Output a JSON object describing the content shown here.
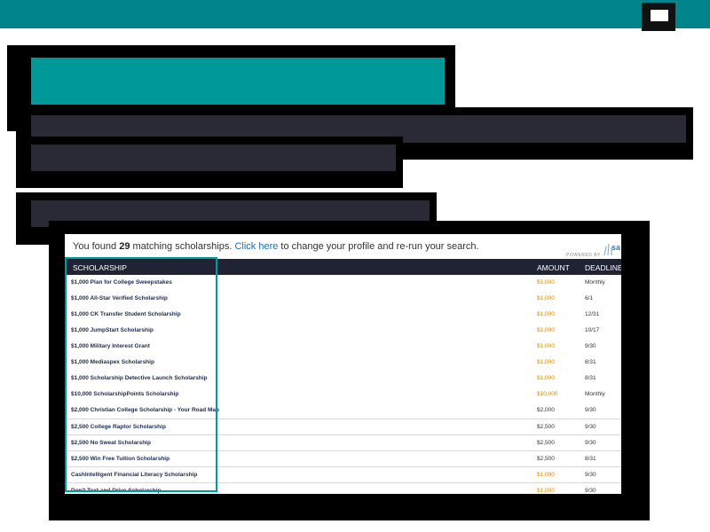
{
  "colors": {
    "brand": "#00838a",
    "accent": "#00999a",
    "dark": "#2a2a37",
    "link": "#1a6fb5",
    "amount": "#d98a00"
  },
  "header": {
    "menu_icon": "hamburger-menu-icon"
  },
  "screenshot": {
    "found_prefix": "You found ",
    "found_count": "29",
    "found_middle": " matching scholarships. ",
    "change_link": "Click here",
    "found_suffix": " to change your profile and re-run your search.",
    "powered_by": "POWERED BY",
    "logo_text": "sa",
    "columns": {
      "name": "SCHOLARSHIP",
      "amount": "AMOUNT",
      "deadline": "DEADLINE"
    },
    "rows": [
      {
        "name": "$1,000 Plan for College Sweepstakes",
        "amount": "$1,000",
        "deadline": "Monthly"
      },
      {
        "name": "$1,000 All-Star Verified Scholarship",
        "amount": "$1,000",
        "deadline": "6/1"
      },
      {
        "name": "$1,000 CK Transfer Student Scholarship",
        "amount": "$1,000",
        "deadline": "12/31"
      },
      {
        "name": "$1,000 JumpStart Scholarship",
        "amount": "$1,000",
        "deadline": "10/17"
      },
      {
        "name": "$1,000 Military Interest Grant",
        "amount": "$1,000",
        "deadline": "9/30"
      },
      {
        "name": "$1,000 Mediaspex Scholarship",
        "amount": "$1,000",
        "deadline": "8/31"
      },
      {
        "name": "$1,000 Scholarship Detective Launch Scholarship",
        "amount": "$1,000",
        "deadline": "8/31"
      },
      {
        "name": "$10,000 ScholarshipPoints Scholarship",
        "amount": "$10,000",
        "deadline": "Monthly"
      },
      {
        "name": "$2,000 Christian College Scholarship - Your Road Map",
        "amount": "$2,000",
        "deadline": "9/30"
      },
      {
        "name": "$2,500 College Raptor Scholarship",
        "amount": "$2,500",
        "deadline": "9/30"
      },
      {
        "name": "$2,500 No Sweat Scholarship",
        "amount": "$2,500",
        "deadline": "9/30"
      },
      {
        "name": "$2,500 Win Free Tuition Scholarship",
        "amount": "$2,500",
        "deadline": "8/31"
      },
      {
        "name": "CashIntelligent Financial Literacy Scholarship",
        "amount": "$1,000",
        "deadline": "9/30"
      },
      {
        "name": "Don't Text and Drive Scholarship",
        "amount": "$1,000",
        "deadline": "9/30"
      }
    ]
  }
}
